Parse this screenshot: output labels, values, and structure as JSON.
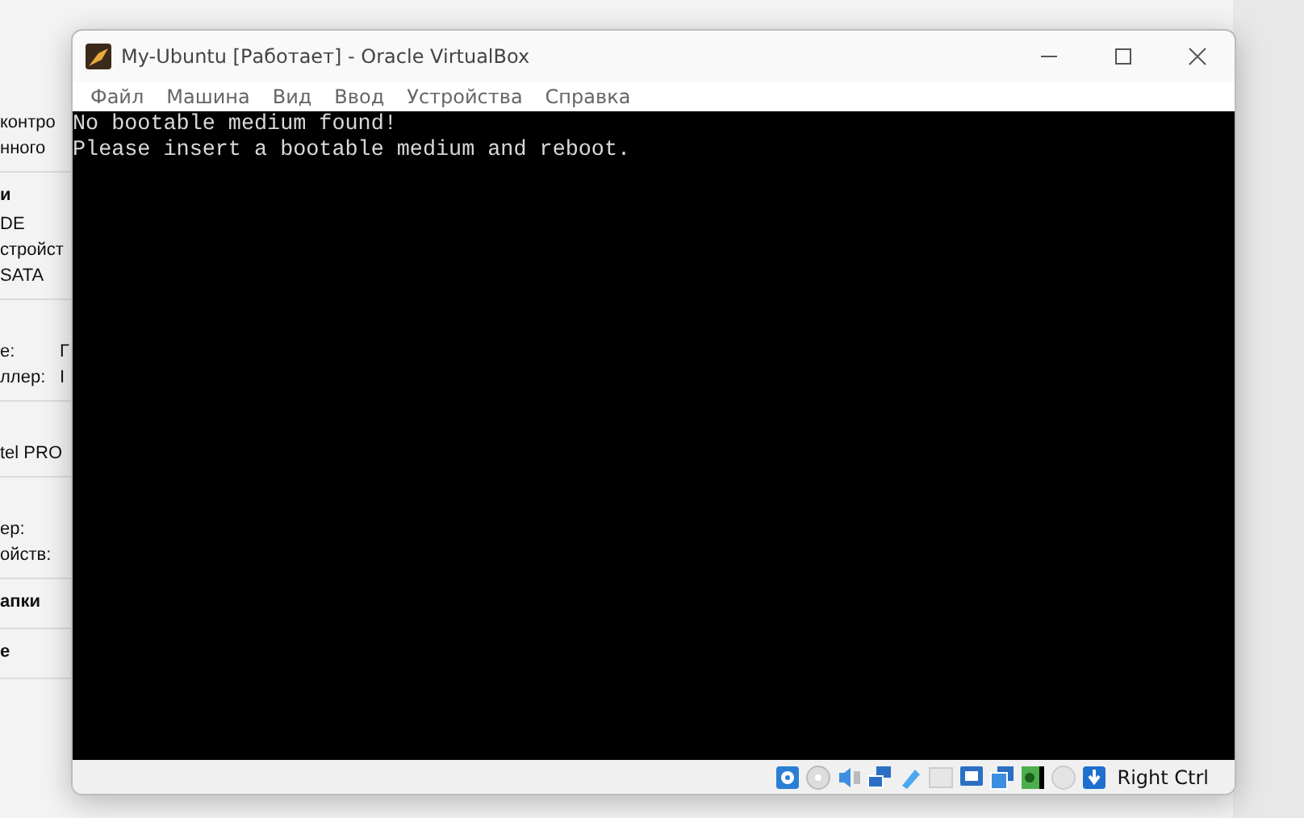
{
  "background_window": {
    "sections": [
      {
        "rows": [
          {
            "label": "контро"
          },
          {
            "label": "нного"
          }
        ]
      },
      {
        "heading": "и",
        "rows": [
          {
            "label": "DE"
          },
          {
            "label": "стройст"
          },
          {
            "label": "SATA"
          }
        ]
      },
      {
        "rows": [
          {
            "label": "е:",
            "value": "Г"
          },
          {
            "label": "ллер:",
            "value": "I"
          }
        ]
      },
      {
        "rows": [
          {
            "label": "tel PRO"
          }
        ]
      },
      {
        "rows": [
          {
            "label": "ер:"
          },
          {
            "label": "ойств:"
          }
        ]
      },
      {
        "heading": "апки"
      },
      {
        "heading": "е"
      }
    ]
  },
  "vm_window": {
    "title": "My-Ubuntu [Работает] - Oracle VirtualBox",
    "menu": [
      "Файл",
      "Машина",
      "Вид",
      "Ввод",
      "Устройства",
      "Справка"
    ],
    "screen_lines": [
      "No bootable medium found!",
      "Please insert a bootable medium and reboot."
    ],
    "host_key": "Right Ctrl"
  }
}
